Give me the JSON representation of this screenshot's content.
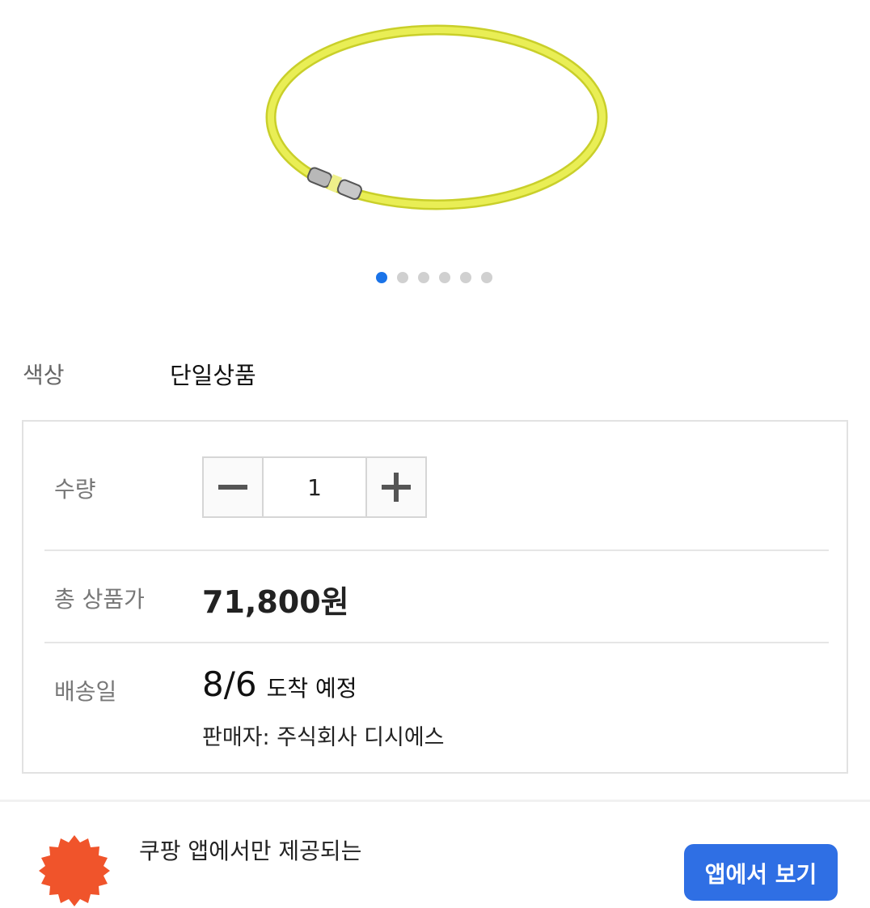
{
  "gallery": {
    "page_count": 6,
    "active_index": 0,
    "product_color": "#e8ec4a"
  },
  "option": {
    "label": "색상",
    "value": "단일상품"
  },
  "quantity": {
    "label": "수량",
    "value": "1",
    "minus_icon": "minus-icon",
    "plus_icon": "plus-icon"
  },
  "total": {
    "label": "총 상품가",
    "price": "71,800원"
  },
  "delivery": {
    "label": "배송일",
    "date": "8/6",
    "suffix": "도착 예정",
    "seller": "판매자: 주식회사 디시에스"
  },
  "banner": {
    "text": "쿠팡 앱에서만 제공되는",
    "badge_icon": "coupang-badge-icon",
    "app_button": "앱에서 보기",
    "accent": "#2f6fe4"
  }
}
